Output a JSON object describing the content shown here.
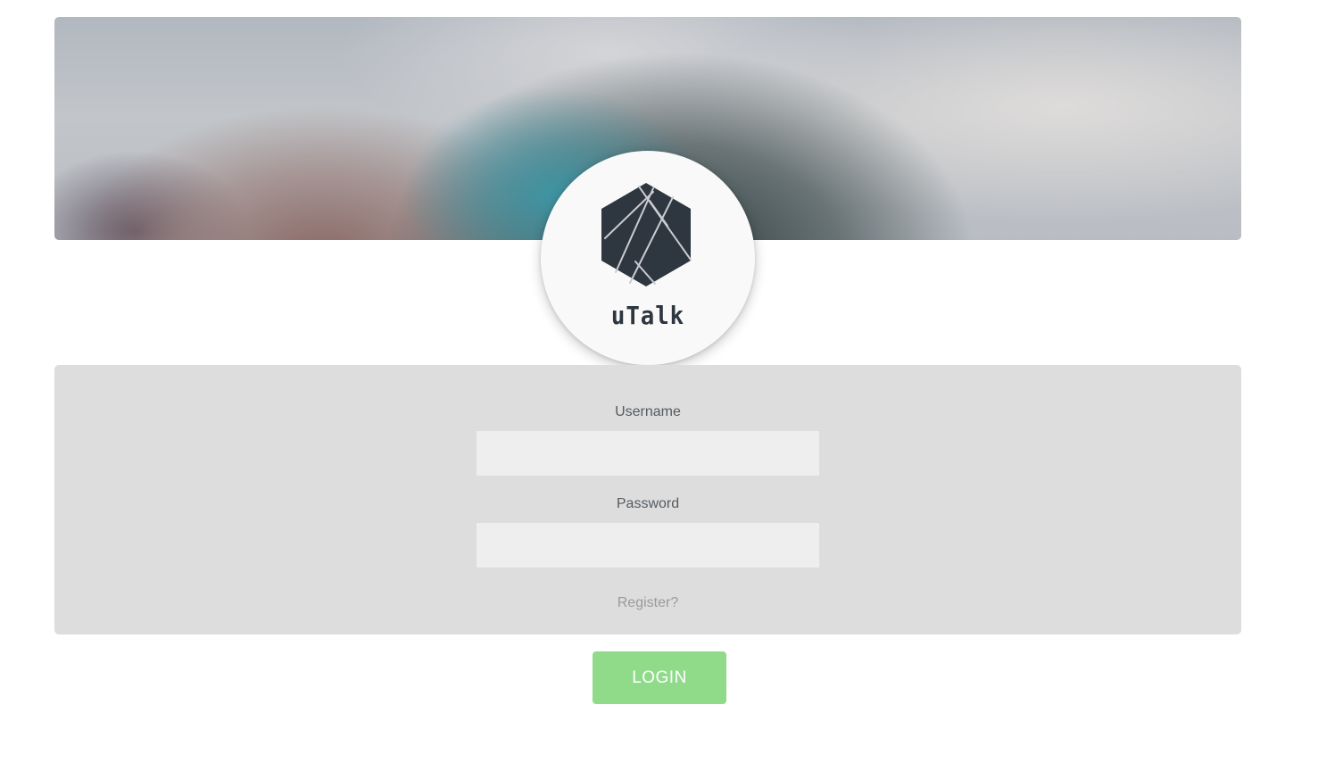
{
  "brand": {
    "name": "uTalk",
    "logo_icon": "hexagon-logo-icon"
  },
  "banner": {
    "image": "blurred-landscape-banner"
  },
  "form": {
    "username_label": "Username",
    "username_value": "",
    "username_placeholder": "",
    "password_label": "Password",
    "password_value": "",
    "password_placeholder": "",
    "register_link": "Register?"
  },
  "actions": {
    "login_label": "LOGIN"
  },
  "colors": {
    "login_button": "#8fdb8a",
    "form_panel": "#dddddd",
    "input_background": "#eeeeee",
    "logo_dark": "#2e3640"
  }
}
